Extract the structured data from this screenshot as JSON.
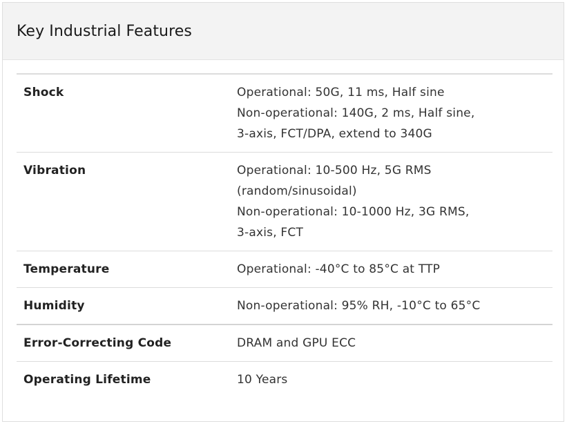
{
  "card": {
    "title": "Key Industrial Features"
  },
  "specs": [
    {
      "label": "Shock",
      "lines": [
        "Operational: 50G, 11 ms, Half sine",
        "Non-operational: 140G, 2 ms, Half sine,",
        "3-axis, FCT/DPA, extend to 340G"
      ]
    },
    {
      "label": "Vibration",
      "lines": [
        "Operational: 10-500 Hz, 5G RMS",
        "(random/sinusoidal)",
        "Non-operational: 10-1000 Hz, 3G RMS,",
        "3-axis, FCT"
      ]
    },
    {
      "label": "Temperature",
      "lines": [
        "Operational: -40°C to 85°C at TTP"
      ]
    },
    {
      "label": "Humidity",
      "lines": [
        "Non-operational: 95% RH, -10°C to 65°C"
      ]
    },
    {
      "label": "Error-Correcting Code",
      "lines": [
        "DRAM and GPU ECC"
      ]
    },
    {
      "label": "Operating Lifetime",
      "lines": [
        "10 Years"
      ]
    }
  ],
  "colors": {
    "header_background": "#f3f3f3",
    "border": "#dcdcdc",
    "label_text": "#222222",
    "value_text": "#333333"
  }
}
